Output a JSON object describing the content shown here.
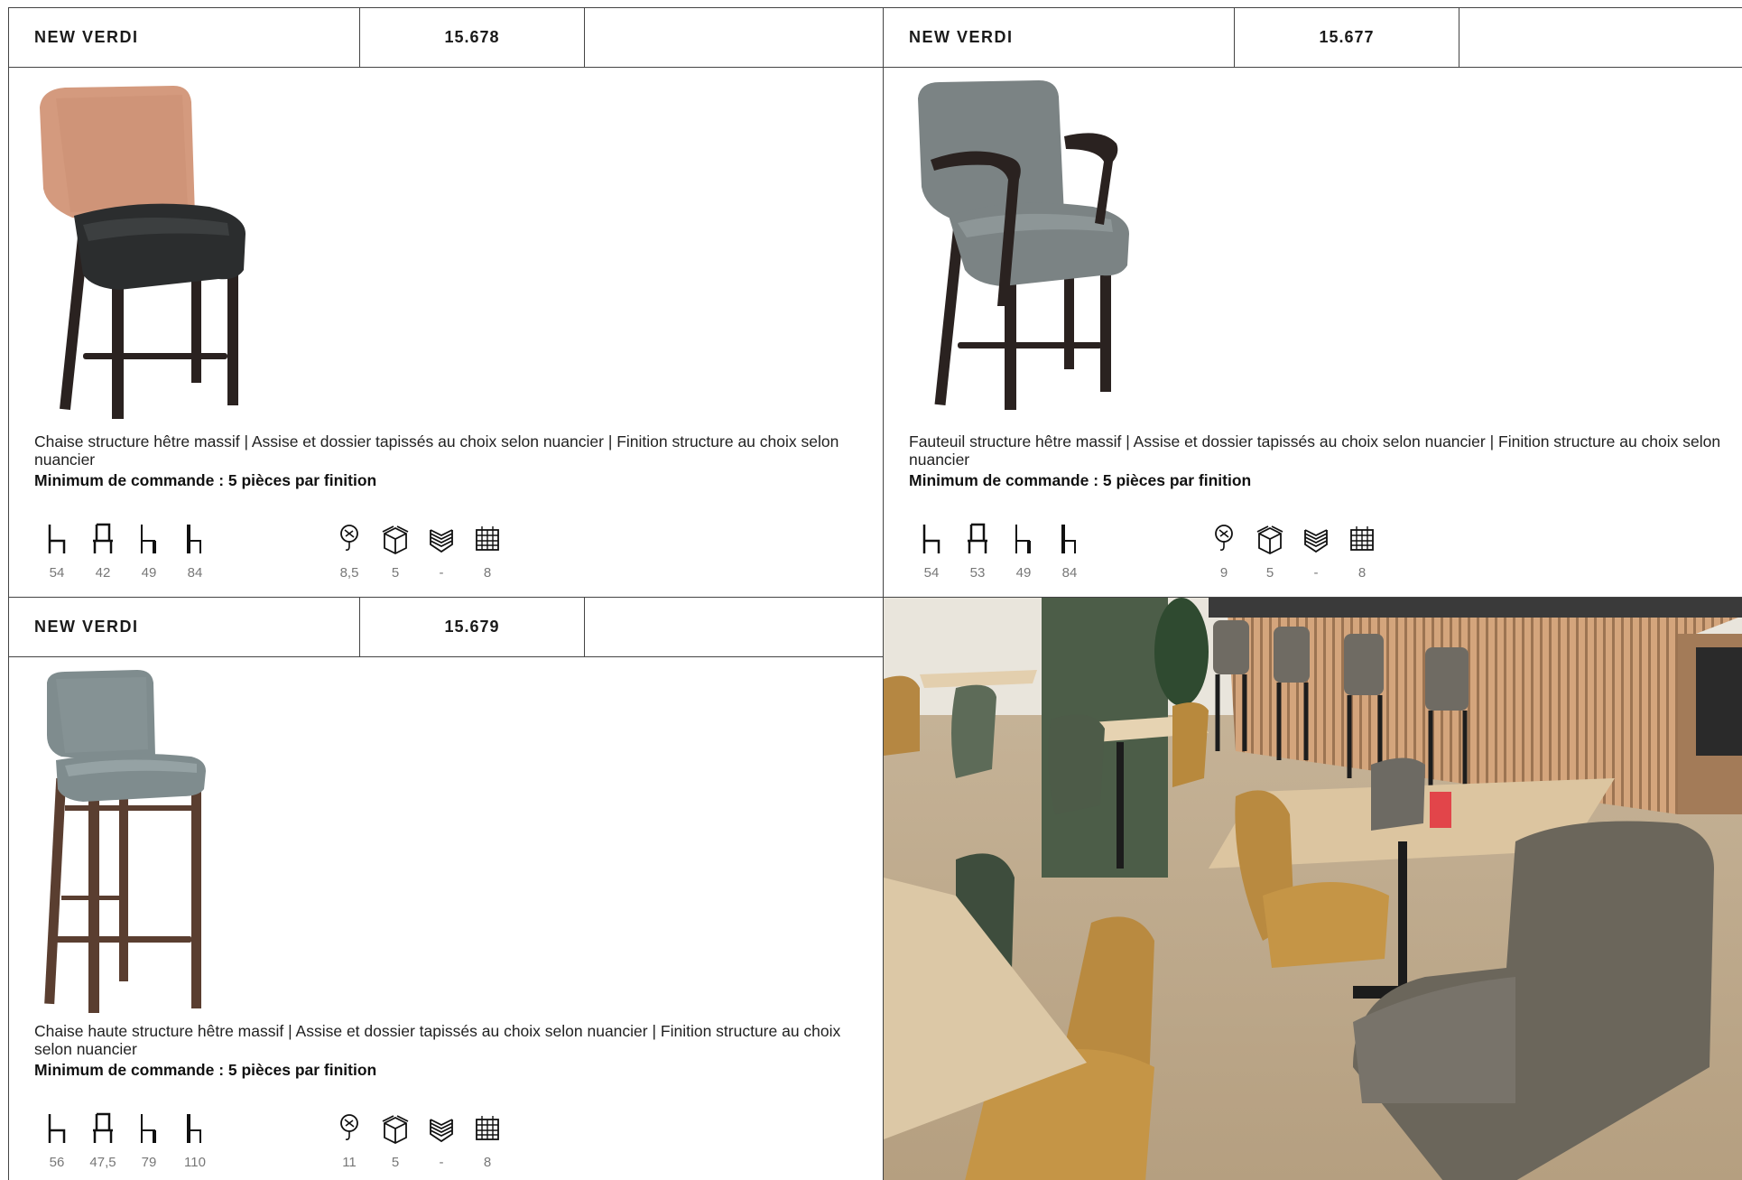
{
  "products": [
    {
      "name": "NEW VERDI",
      "ref": "15.678",
      "image_icon": "chair-icon",
      "description": "Chaise structure hêtre massif | Assise et dossier tapissés au choix selon nuancier | Finition structure au choix selon nuancier",
      "min_order": "Minimum de commande : 5 pièces par finition",
      "dimensions": [
        "54",
        "42",
        "49",
        "84"
      ],
      "specs": [
        "8,5",
        "5",
        "-",
        "8"
      ]
    },
    {
      "name": "NEW VERDI",
      "ref": "15.677",
      "image_icon": "armchair-icon",
      "description": "Fauteuil structure hêtre massif | Assise et dossier tapissés au choix selon nuancier | Finition structure au choix selon nuancier",
      "min_order": "Minimum de commande : 5 pièces par finition",
      "dimensions": [
        "54",
        "53",
        "49",
        "84"
      ],
      "specs": [
        "9",
        "5",
        "-",
        "8"
      ]
    },
    {
      "name": "NEW VERDI",
      "ref": "15.679",
      "image_icon": "bar-stool-icon",
      "description": "Chaise haute structure hêtre massif | Assise et dossier tapissés au choix selon nuancier | Finition structure au choix selon nuancier",
      "min_order": "Minimum de commande : 5 pièces par finition",
      "dimensions": [
        "56",
        "47,5",
        "79",
        "110"
      ],
      "specs": [
        "11",
        "5",
        "-",
        "8"
      ]
    }
  ],
  "icon_names": [
    "depth-icon",
    "width-icon",
    "seat-height-icon",
    "total-height-icon",
    "weight-icon",
    "box-icon",
    "stacking-icon",
    "calendar-icon"
  ],
  "colors": {
    "border": "#444444",
    "chair1_back": "#d49a7e",
    "chair1_seat": "#2b2d2e",
    "chair2_upholstery": "#7b8384",
    "chair3_upholstery": "#7f8c8e",
    "wood_dark": "#2a2220",
    "wood_walnut": "#5a3e30"
  }
}
